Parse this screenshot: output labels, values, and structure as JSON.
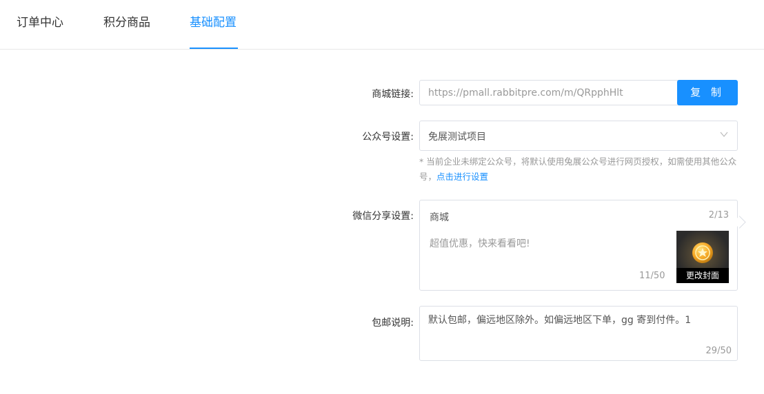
{
  "tabs": [
    {
      "label": "订单中心",
      "active": false
    },
    {
      "label": "积分商品",
      "active": false
    },
    {
      "label": "基础配置",
      "active": true
    }
  ],
  "form": {
    "mall_link": {
      "label": "商城链接:",
      "value": "https://pmall.rabbitpre.com/m/QRpphHlt",
      "copy_label": "复 制"
    },
    "official_account": {
      "label": "公众号设置:",
      "selected": "免展测试项目",
      "hint_text": "* 当前企业未绑定公众号，将默认使用兔展公众号进行网页授权，如需使用其他公众号，",
      "hint_link": "点击进行设置"
    },
    "wechat_share": {
      "label": "微信分享设置:",
      "title": "商城",
      "title_count": "2/13",
      "description": "超值优惠，快来看看吧!",
      "description_count": "11/50",
      "cover_label": "更改封面"
    },
    "shipping": {
      "label": "包邮说明:",
      "value": "默认包邮，偏远地区除外。如偏远地区下单，gg 寄到付件。1",
      "count": "29/50"
    }
  },
  "colors": {
    "accent": "#1890ff",
    "border": "#dcdfe6",
    "muted": "#999999"
  }
}
